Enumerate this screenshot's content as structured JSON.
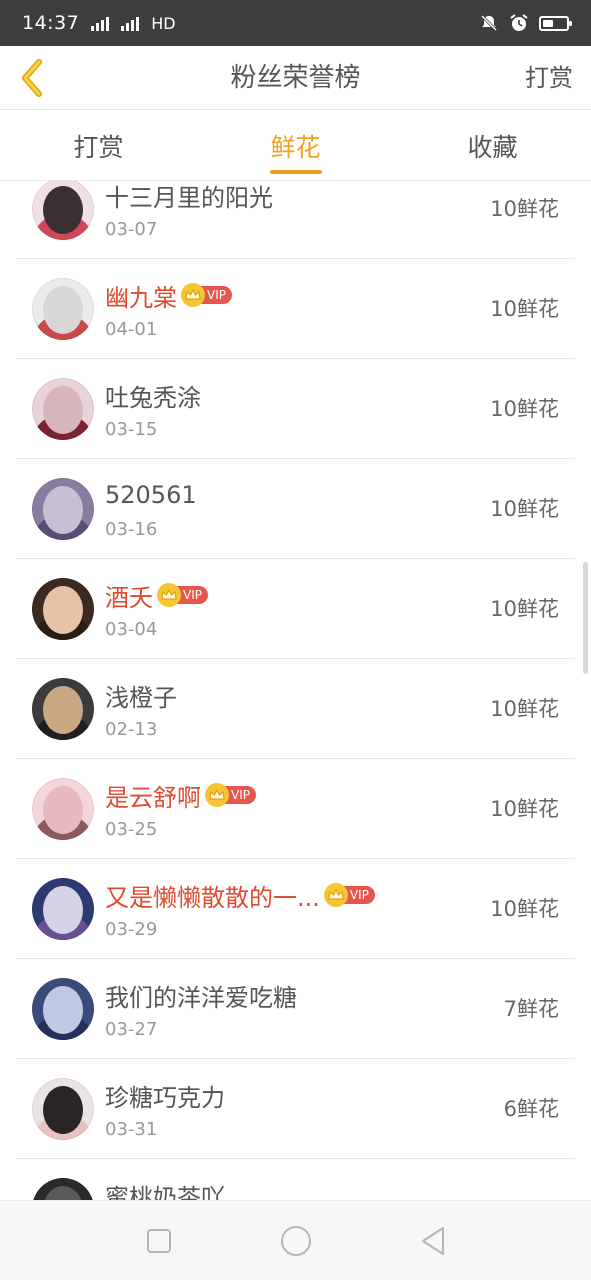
{
  "status_bar": {
    "time": "14:37",
    "network_label": "4G",
    "hd": "HD"
  },
  "header": {
    "title": "粉丝荣誉榜",
    "action": "打赏"
  },
  "tabs": [
    {
      "label": "打赏",
      "active": false
    },
    {
      "label": "鲜花",
      "active": true
    },
    {
      "label": "收藏",
      "active": false
    }
  ],
  "vip_label": "VIP",
  "list": [
    {
      "name": "十三月里的阳光",
      "date": "03-07",
      "amount": "10鲜花",
      "vip": false,
      "avatar_colors": [
        "#f0e0e6",
        "#3a2f33",
        "#d2485b"
      ]
    },
    {
      "name": "幽九棠",
      "date": "04-01",
      "amount": "10鲜花",
      "vip": true,
      "avatar_colors": [
        "#eceaea",
        "#d9d6d6",
        "#c64b4b"
      ]
    },
    {
      "name": "吐兔秃涂",
      "date": "03-15",
      "amount": "10鲜花",
      "vip": false,
      "avatar_colors": [
        "#e9d3d8",
        "#d6b5bd",
        "#7a2331"
      ]
    },
    {
      "name": "520561",
      "date": "03-16",
      "amount": "10鲜花",
      "vip": false,
      "avatar_colors": [
        "#8a7ba0",
        "#c7c0d4",
        "#5b4c74"
      ]
    },
    {
      "name": "酒夭",
      "date": "03-04",
      "amount": "10鲜花",
      "vip": true,
      "avatar_colors": [
        "#3b2a1f",
        "#e6c3a6",
        "#2a1d16"
      ]
    },
    {
      "name": "浅橙子",
      "date": "02-13",
      "amount": "10鲜花",
      "vip": false,
      "avatar_colors": [
        "#3b3b3b",
        "#c9a883",
        "#1f1f1f"
      ]
    },
    {
      "name": "是云舒啊",
      "date": "03-25",
      "amount": "10鲜花",
      "vip": true,
      "avatar_colors": [
        "#f4d6da",
        "#e7b8bd",
        "#8c5a5e"
      ]
    },
    {
      "name": "又是懒懒散散的一...",
      "date": "03-29",
      "amount": "10鲜花",
      "vip": true,
      "avatar_colors": [
        "#2d3a72",
        "#d6d2e8",
        "#6b4f94"
      ]
    },
    {
      "name": "我们的洋洋爱吃糖",
      "date": "03-27",
      "amount": "7鲜花",
      "vip": false,
      "avatar_colors": [
        "#3a4a7a",
        "#bfc9e3",
        "#27305a"
      ]
    },
    {
      "name": "珍糖巧克力",
      "date": "03-31",
      "amount": "6鲜花",
      "vip": false,
      "avatar_colors": [
        "#e9e3e3",
        "#2b2424",
        "#e6c2c2"
      ]
    },
    {
      "name": "蜜桃奶茶吖",
      "date": "",
      "amount": "",
      "vip": false,
      "avatar_colors": [
        "#2a2a2a",
        "#5a5a5a",
        "#1a1a1a"
      ]
    }
  ],
  "colors": {
    "accent": "#f0a020",
    "vip_name": "#e14a30",
    "vip_tag": "#e7564c",
    "crown": "#f7c531"
  },
  "icons": [
    "back-chevron-icon",
    "crown-icon",
    "square-nav-icon",
    "circle-nav-icon",
    "triangle-back-nav-icon"
  ]
}
